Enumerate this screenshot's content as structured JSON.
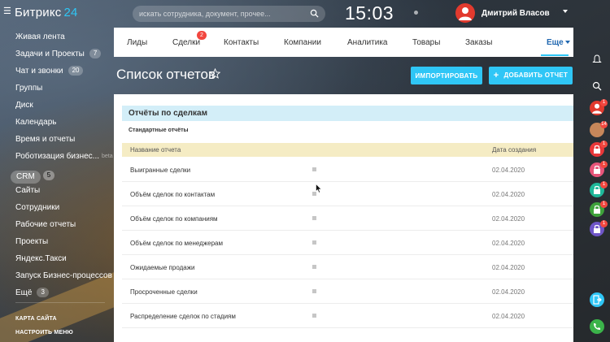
{
  "app": {
    "logo_text": "Битрикс",
    "logo_number": "24",
    "search_placeholder": "искать сотрудника, документ, прочее...",
    "clock": "15:03",
    "user_name": "Дмитрий Власов"
  },
  "sidebar": {
    "items": [
      {
        "label": "Живая лента"
      },
      {
        "label": "Задачи и Проекты",
        "counter": "7"
      },
      {
        "label": "Чат и звонки",
        "counter": "20"
      },
      {
        "label": "Группы"
      },
      {
        "label": "Диск"
      },
      {
        "label": "Календарь"
      },
      {
        "label": "Время и отчеты"
      },
      {
        "label": "Роботизация бизнес...",
        "tag": "beta"
      },
      {
        "label": "CRM",
        "counter": "5"
      },
      {
        "label": "Сайты"
      },
      {
        "label": "Сотрудники"
      },
      {
        "label": "Рабочие отчеты"
      },
      {
        "label": "Проекты"
      },
      {
        "label": "Яндекс.Такси"
      },
      {
        "label": "Запуск Бизнес-процессов"
      },
      {
        "label": "Ещё",
        "counter": "3"
      }
    ],
    "sitemap": "КАРТА САЙТА",
    "settings": "НАСТРОИТЬ МЕНЮ"
  },
  "tabs": [
    {
      "label": "Лиды"
    },
    {
      "label": "Сделки",
      "badge": "2"
    },
    {
      "label": "Контакты"
    },
    {
      "label": "Компании"
    },
    {
      "label": "Аналитика"
    },
    {
      "label": "Товары"
    },
    {
      "label": "Заказы"
    },
    {
      "label": "Еще"
    }
  ],
  "page": {
    "title": "Список отчетов",
    "import_button": "ИМПОРТИРОВАТЬ",
    "add_button": "ДОБАВИТЬ ОТЧЕТ"
  },
  "reports": {
    "section_title": "Отчёты по сделкам",
    "subsection": "Стандартные отчёты",
    "col_name": "Название отчета",
    "col_date": "Дата создания",
    "rows": [
      {
        "name": "Выигранные сделки",
        "date": "02.04.2020"
      },
      {
        "name": "Объём сделок по контактам",
        "date": "02.04.2020"
      },
      {
        "name": "Объём сделок по компаниям",
        "date": "02.04.2020"
      },
      {
        "name": "Объём сделок по менеджерам",
        "date": "02.04.2020"
      },
      {
        "name": "Ожидаемые продажи",
        "date": "02.04.2020"
      },
      {
        "name": "Просроченные сделки",
        "date": "02.04.2020"
      },
      {
        "name": "Распределение сделок по стадиям",
        "date": "02.04.2020"
      }
    ]
  },
  "rail": {
    "badges": [
      "1",
      "14",
      "1",
      "1",
      "1",
      "1",
      "1"
    ],
    "colors": {
      "avatar_red": "#e23a2e",
      "avatar_photo": "#c7875a",
      "lock_red": "#e8383a",
      "lock_pink": "#e8557a",
      "lock_teal": "#1fb89a",
      "lock_green": "#3fa33b",
      "lock_purple": "#6f56c8",
      "action_blue": "#2fc6f6",
      "action_green": "#3bb34a"
    }
  },
  "colors": {
    "accent": "#2fc6f6",
    "badge_red": "#f2473f",
    "section_head": "#d3eef8",
    "table_head": "#f5ecc4"
  }
}
